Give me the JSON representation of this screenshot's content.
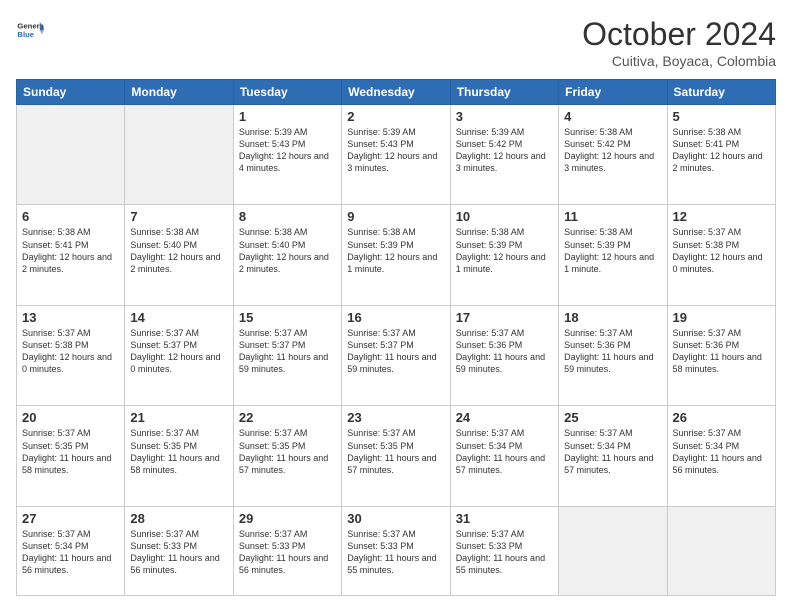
{
  "logo": {
    "general": "General",
    "blue": "Blue"
  },
  "header": {
    "month": "October 2024",
    "location": "Cuitiva, Boyaca, Colombia"
  },
  "weekdays": [
    "Sunday",
    "Monday",
    "Tuesday",
    "Wednesday",
    "Thursday",
    "Friday",
    "Saturday"
  ],
  "weeks": [
    [
      {
        "day": "",
        "empty": true
      },
      {
        "day": "",
        "empty": true
      },
      {
        "day": "1",
        "sunrise": "Sunrise: 5:39 AM",
        "sunset": "Sunset: 5:43 PM",
        "daylight": "Daylight: 12 hours and 4 minutes."
      },
      {
        "day": "2",
        "sunrise": "Sunrise: 5:39 AM",
        "sunset": "Sunset: 5:43 PM",
        "daylight": "Daylight: 12 hours and 3 minutes."
      },
      {
        "day": "3",
        "sunrise": "Sunrise: 5:39 AM",
        "sunset": "Sunset: 5:42 PM",
        "daylight": "Daylight: 12 hours and 3 minutes."
      },
      {
        "day": "4",
        "sunrise": "Sunrise: 5:38 AM",
        "sunset": "Sunset: 5:42 PM",
        "daylight": "Daylight: 12 hours and 3 minutes."
      },
      {
        "day": "5",
        "sunrise": "Sunrise: 5:38 AM",
        "sunset": "Sunset: 5:41 PM",
        "daylight": "Daylight: 12 hours and 2 minutes."
      }
    ],
    [
      {
        "day": "6",
        "sunrise": "Sunrise: 5:38 AM",
        "sunset": "Sunset: 5:41 PM",
        "daylight": "Daylight: 12 hours and 2 minutes."
      },
      {
        "day": "7",
        "sunrise": "Sunrise: 5:38 AM",
        "sunset": "Sunset: 5:40 PM",
        "daylight": "Daylight: 12 hours and 2 minutes."
      },
      {
        "day": "8",
        "sunrise": "Sunrise: 5:38 AM",
        "sunset": "Sunset: 5:40 PM",
        "daylight": "Daylight: 12 hours and 2 minutes."
      },
      {
        "day": "9",
        "sunrise": "Sunrise: 5:38 AM",
        "sunset": "Sunset: 5:39 PM",
        "daylight": "Daylight: 12 hours and 1 minute."
      },
      {
        "day": "10",
        "sunrise": "Sunrise: 5:38 AM",
        "sunset": "Sunset: 5:39 PM",
        "daylight": "Daylight: 12 hours and 1 minute."
      },
      {
        "day": "11",
        "sunrise": "Sunrise: 5:38 AM",
        "sunset": "Sunset: 5:39 PM",
        "daylight": "Daylight: 12 hours and 1 minute."
      },
      {
        "day": "12",
        "sunrise": "Sunrise: 5:37 AM",
        "sunset": "Sunset: 5:38 PM",
        "daylight": "Daylight: 12 hours and 0 minutes."
      }
    ],
    [
      {
        "day": "13",
        "sunrise": "Sunrise: 5:37 AM",
        "sunset": "Sunset: 5:38 PM",
        "daylight": "Daylight: 12 hours and 0 minutes."
      },
      {
        "day": "14",
        "sunrise": "Sunrise: 5:37 AM",
        "sunset": "Sunset: 5:37 PM",
        "daylight": "Daylight: 12 hours and 0 minutes."
      },
      {
        "day": "15",
        "sunrise": "Sunrise: 5:37 AM",
        "sunset": "Sunset: 5:37 PM",
        "daylight": "Daylight: 11 hours and 59 minutes."
      },
      {
        "day": "16",
        "sunrise": "Sunrise: 5:37 AM",
        "sunset": "Sunset: 5:37 PM",
        "daylight": "Daylight: 11 hours and 59 minutes."
      },
      {
        "day": "17",
        "sunrise": "Sunrise: 5:37 AM",
        "sunset": "Sunset: 5:36 PM",
        "daylight": "Daylight: 11 hours and 59 minutes."
      },
      {
        "day": "18",
        "sunrise": "Sunrise: 5:37 AM",
        "sunset": "Sunset: 5:36 PM",
        "daylight": "Daylight: 11 hours and 59 minutes."
      },
      {
        "day": "19",
        "sunrise": "Sunrise: 5:37 AM",
        "sunset": "Sunset: 5:36 PM",
        "daylight": "Daylight: 11 hours and 58 minutes."
      }
    ],
    [
      {
        "day": "20",
        "sunrise": "Sunrise: 5:37 AM",
        "sunset": "Sunset: 5:35 PM",
        "daylight": "Daylight: 11 hours and 58 minutes."
      },
      {
        "day": "21",
        "sunrise": "Sunrise: 5:37 AM",
        "sunset": "Sunset: 5:35 PM",
        "daylight": "Daylight: 11 hours and 58 minutes."
      },
      {
        "day": "22",
        "sunrise": "Sunrise: 5:37 AM",
        "sunset": "Sunset: 5:35 PM",
        "daylight": "Daylight: 11 hours and 57 minutes."
      },
      {
        "day": "23",
        "sunrise": "Sunrise: 5:37 AM",
        "sunset": "Sunset: 5:35 PM",
        "daylight": "Daylight: 11 hours and 57 minutes."
      },
      {
        "day": "24",
        "sunrise": "Sunrise: 5:37 AM",
        "sunset": "Sunset: 5:34 PM",
        "daylight": "Daylight: 11 hours and 57 minutes."
      },
      {
        "day": "25",
        "sunrise": "Sunrise: 5:37 AM",
        "sunset": "Sunset: 5:34 PM",
        "daylight": "Daylight: 11 hours and 57 minutes."
      },
      {
        "day": "26",
        "sunrise": "Sunrise: 5:37 AM",
        "sunset": "Sunset: 5:34 PM",
        "daylight": "Daylight: 11 hours and 56 minutes."
      }
    ],
    [
      {
        "day": "27",
        "sunrise": "Sunrise: 5:37 AM",
        "sunset": "Sunset: 5:34 PM",
        "daylight": "Daylight: 11 hours and 56 minutes."
      },
      {
        "day": "28",
        "sunrise": "Sunrise: 5:37 AM",
        "sunset": "Sunset: 5:33 PM",
        "daylight": "Daylight: 11 hours and 56 minutes."
      },
      {
        "day": "29",
        "sunrise": "Sunrise: 5:37 AM",
        "sunset": "Sunset: 5:33 PM",
        "daylight": "Daylight: 11 hours and 56 minutes."
      },
      {
        "day": "30",
        "sunrise": "Sunrise: 5:37 AM",
        "sunset": "Sunset: 5:33 PM",
        "daylight": "Daylight: 11 hours and 55 minutes."
      },
      {
        "day": "31",
        "sunrise": "Sunrise: 5:37 AM",
        "sunset": "Sunset: 5:33 PM",
        "daylight": "Daylight: 11 hours and 55 minutes."
      },
      {
        "day": "",
        "empty": true
      },
      {
        "day": "",
        "empty": true
      }
    ]
  ]
}
